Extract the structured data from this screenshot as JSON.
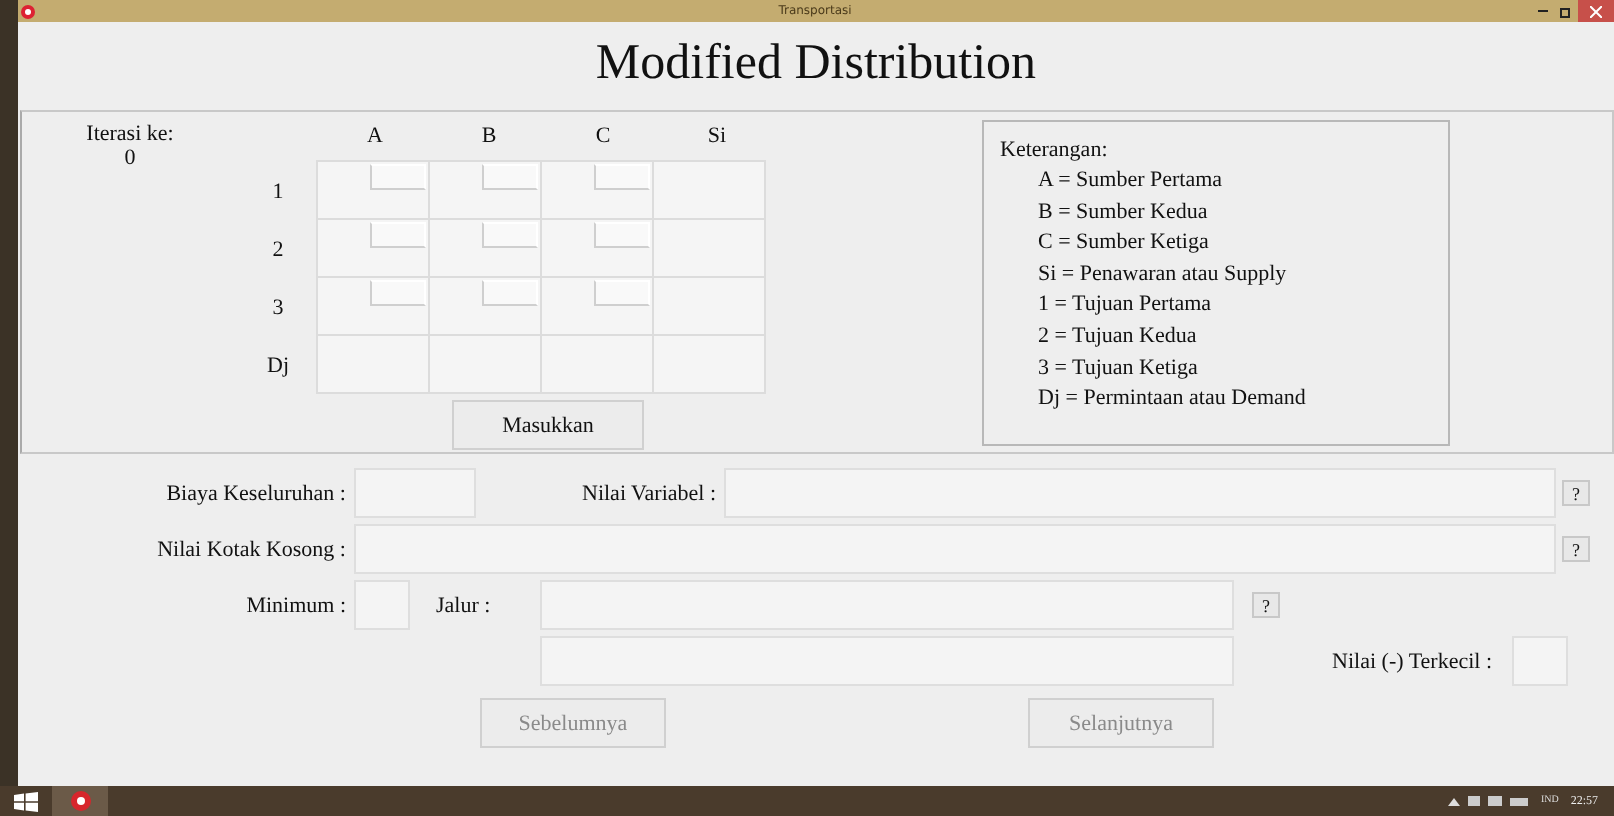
{
  "window": {
    "title": "Transportasi"
  },
  "heading": "Modified Distribution",
  "iteration": {
    "label": "Iterasi ke:",
    "value": "0"
  },
  "table": {
    "columns": [
      {
        "label": "A",
        "kind": "source"
      },
      {
        "label": "B",
        "kind": "source"
      },
      {
        "label": "C",
        "kind": "source"
      },
      {
        "label": "Si",
        "kind": "supply"
      }
    ],
    "rows": [
      {
        "label": "1",
        "kind": "destination"
      },
      {
        "label": "2",
        "kind": "destination"
      },
      {
        "label": "3",
        "kind": "destination"
      },
      {
        "label": "Dj",
        "kind": "demand"
      }
    ]
  },
  "submit_button": {
    "label": "Masukkan",
    "disabled": false
  },
  "legend": {
    "title": "Keterangan:",
    "items": [
      "A = Sumber Pertama",
      "B = Sumber Kedua",
      "C = Sumber Ketiga",
      "Si = Penawaran atau Supply",
      "1 = Tujuan Pertama",
      "2 = Tujuan Kedua",
      "3 = Tujuan Ketiga",
      "Dj = Permintaan atau Demand"
    ]
  },
  "results": {
    "total_cost": {
      "label": "Biaya Keseluruhan :"
    },
    "variable_values": {
      "label": "Nilai Variabel :",
      "help": "?"
    },
    "empty_cell_values": {
      "label": "Nilai Kotak Kosong :",
      "help": "?"
    },
    "minimum": {
      "label": "Minimum :"
    },
    "path": {
      "label": "Jalur :",
      "help": "?"
    },
    "smallest_negative": {
      "label": "Nilai (-) Terkecil :"
    }
  },
  "nav_buttons": [
    {
      "label": "Sebelumnya",
      "disabled": true
    },
    {
      "label": "Selanjutnya",
      "disabled": true
    }
  ],
  "taskbar": {
    "language": "IND",
    "clock": "22:57"
  }
}
